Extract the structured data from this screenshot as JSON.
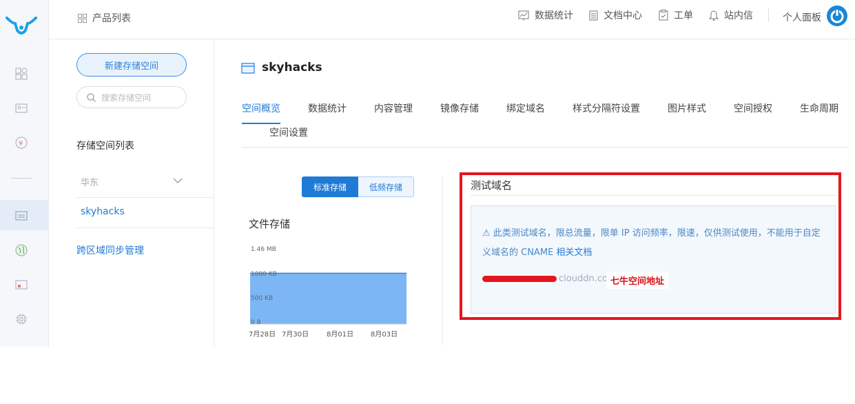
{
  "header": {
    "breadcrumb": "产品列表",
    "nav": [
      {
        "label": "数据统计",
        "icon": "chart-icon"
      },
      {
        "label": "文档中心",
        "icon": "document-icon"
      },
      {
        "label": "工单",
        "icon": "clipboard-icon"
      },
      {
        "label": "站内信",
        "icon": "bell-icon"
      }
    ],
    "user_panel": "个人面板"
  },
  "sidebar": {
    "new_bucket_button": "新建存储空间",
    "search_placeholder": "搜索存储空间",
    "list_title": "存储空间列表",
    "region": "华东",
    "bucket": "skyhacks",
    "cross_region": "跨区域同步管理"
  },
  "main": {
    "bucket_title": "skyhacks",
    "tabs": [
      "空间概览",
      "数据统计",
      "内容管理",
      "镜像存储",
      "绑定域名",
      "样式分隔符设置",
      "图片样式",
      "空间授权",
      "生命周期",
      "空间设置"
    ],
    "active_tab": "空间概览",
    "storage_toggle": [
      "标准存储",
      "低频存储"
    ],
    "file_storage_title": "文件存储",
    "chart_data": {
      "type": "area",
      "title": "文件存储",
      "y_ticks": [
        "1.46 MB",
        "1000 KB",
        "500 KB",
        "0 B"
      ],
      "x_ticks": [
        "7月28日",
        "7月30日",
        "8月01日",
        "8月03日"
      ],
      "series": [
        {
          "values": [
            "1000 KB",
            "1000 KB",
            "1000 KB",
            "1000 KB"
          ]
        }
      ],
      "color": "#7db6f5"
    },
    "test_domain": {
      "title": "测试域名",
      "warning": "此类测试域名，限总流量，限单 IP 访问频率，限速，仅供测试使用，不能用于自定义域名的 CNAME",
      "doc_link": "相关文档",
      "domain_suffix": "clouddn.com",
      "annotation": "七牛空间地址"
    }
  },
  "colors": {
    "accent": "#1f7ad6",
    "highlight_box": "#e3161f",
    "annotation": "#d4111a"
  }
}
